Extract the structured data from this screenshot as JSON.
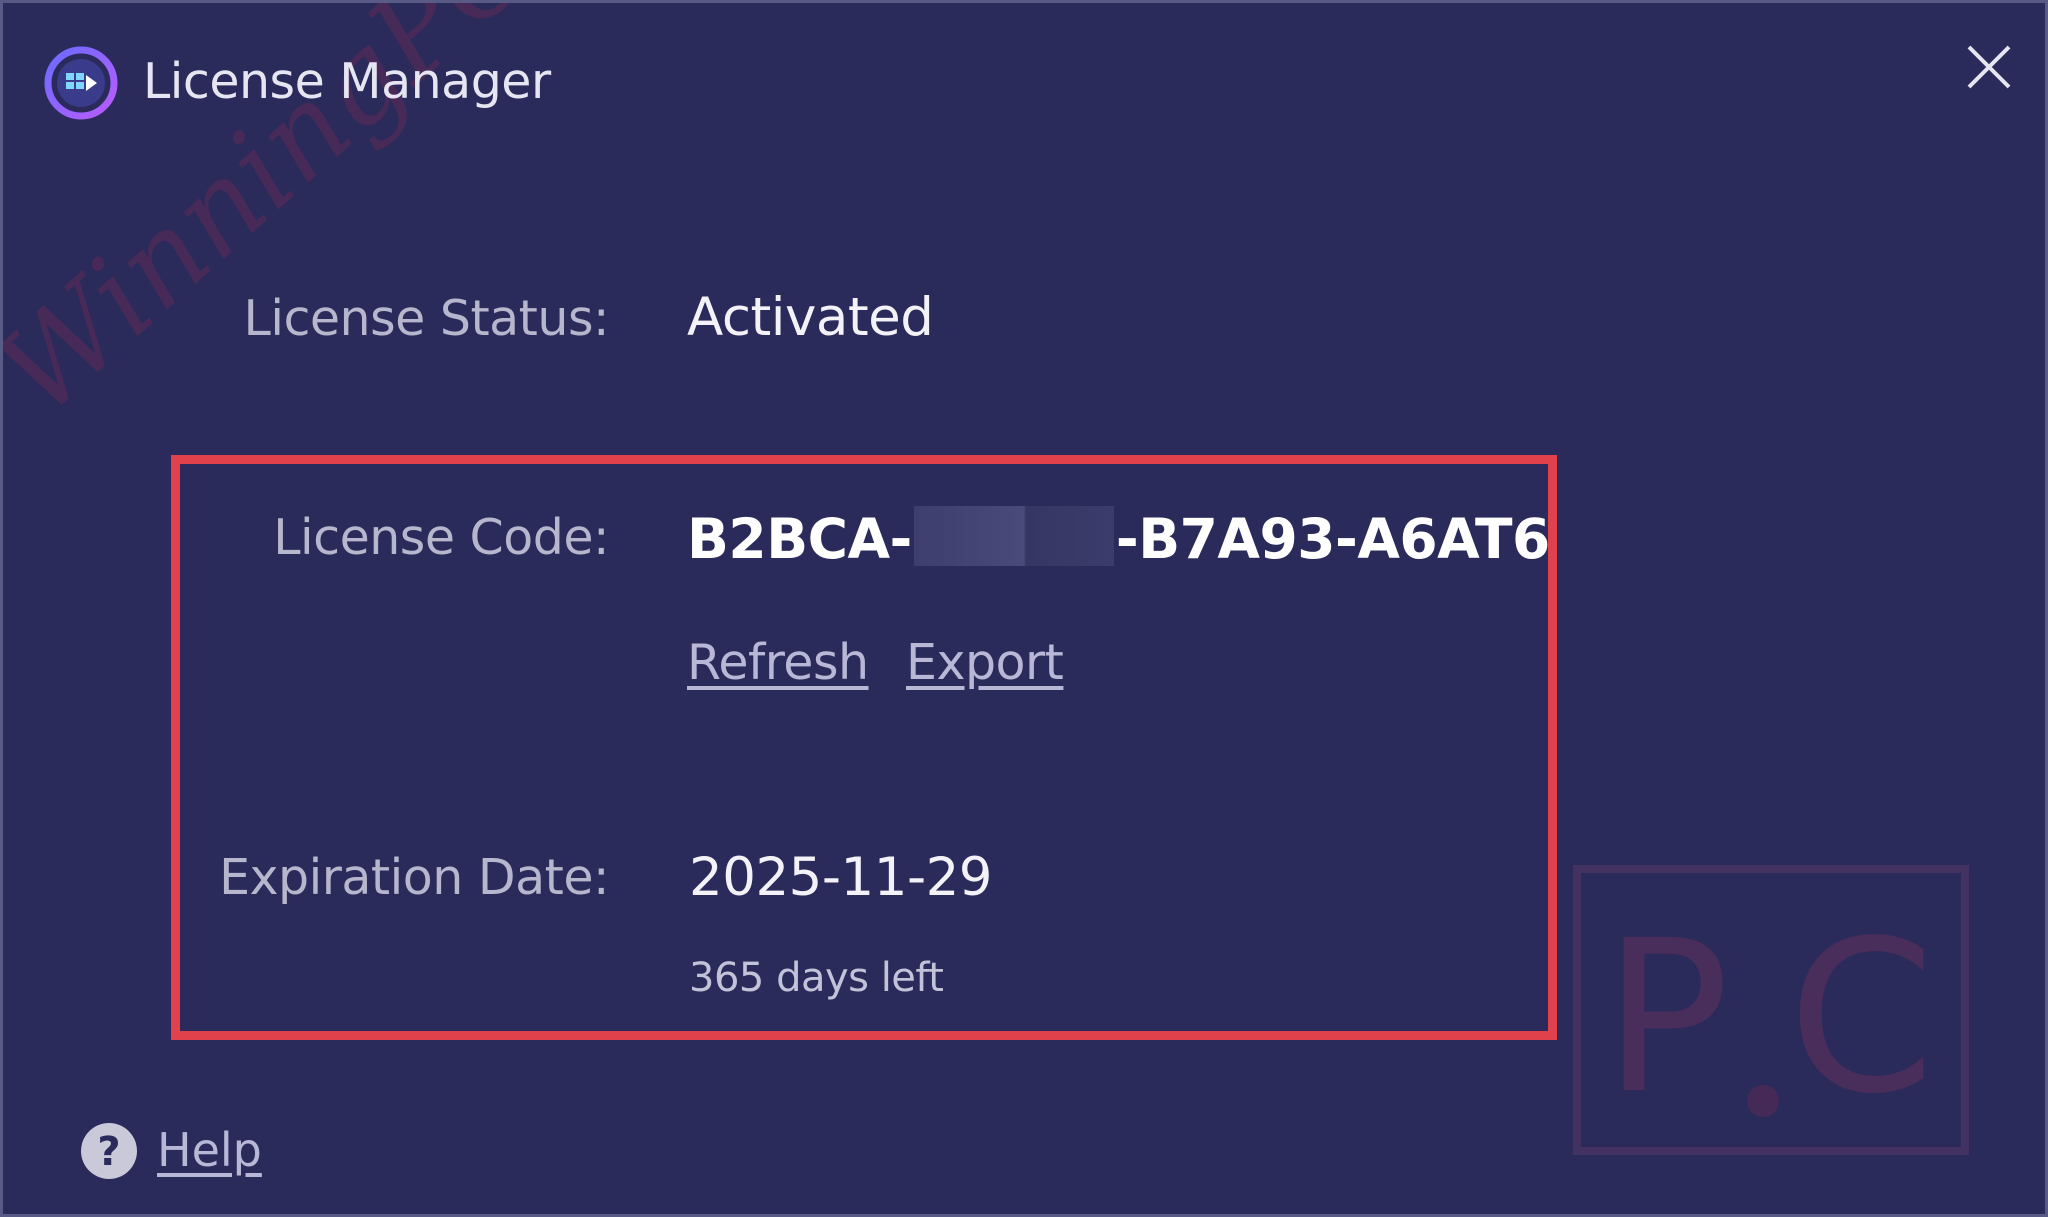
{
  "window": {
    "title": "License Manager",
    "icon": "app-logo-icon",
    "close_icon": "close-icon"
  },
  "status": {
    "label": "License Status:",
    "value": "Activated"
  },
  "code": {
    "label": "License Code:",
    "prefix": "B2BCA-",
    "suffix": "-B7A93-A6AT6"
  },
  "actions": {
    "refresh": "Refresh",
    "export": "Export"
  },
  "expiration": {
    "label": "Expiration Date:",
    "date": "2025-11-29",
    "days_left": "365 days left"
  },
  "help": {
    "label": "Help",
    "icon": "help-circle-icon"
  },
  "watermark": {
    "text": "WinningPC",
    "logo": "P.C"
  },
  "colors": {
    "background": "#2b2b5b",
    "highlight": "#e0414b",
    "link": "#b8b8d6"
  }
}
